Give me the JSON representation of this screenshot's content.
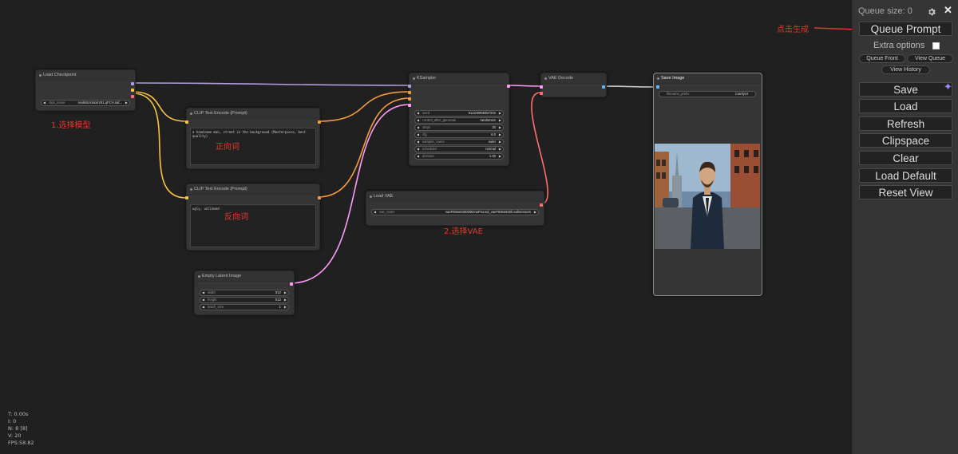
{
  "nodes": {
    "load_checkpoint": {
      "title": "Load Checkpoint",
      "ckpt_name_label": "ckpt_name",
      "ckpt_name_value": "realisticVisionV51.qFCH.saf..."
    },
    "clip_pos": {
      "title": "CLIP Text Encode (Prompt)",
      "text": "a handsome man, street in the background (Masterpiece, best quality)"
    },
    "clip_neg": {
      "title": "CLIP Text Encode (Prompt)",
      "text": "ugly, unlimned"
    },
    "empty_latent": {
      "title": "Empty Latent Image",
      "widgets": [
        {
          "name": "width",
          "value": "512"
        },
        {
          "name": "height",
          "value": "512"
        },
        {
          "name": "batch_size",
          "value": "1"
        }
      ]
    },
    "ksampler": {
      "title": "KSampler",
      "widgets": [
        {
          "name": "seed",
          "value": "511100958357202"
        },
        {
          "name": "control_after_generate",
          "value": "randomize"
        },
        {
          "name": "steps",
          "value": "20"
        },
        {
          "name": "cfg",
          "value": "6.0"
        },
        {
          "name": "sampler_name",
          "value": "euler"
        },
        {
          "name": "scheduler",
          "value": "normal"
        },
        {
          "name": "denoise",
          "value": "1.00"
        }
      ]
    },
    "vae_decode": {
      "title": "VAE Decode"
    },
    "load_vae": {
      "title": "Load VAE",
      "vae_name_label": "vae_name",
      "vae_name_value": "vaeFtMse840000EmaPruned_vaeFtMse840k.safetensors"
    },
    "save_image": {
      "title": "Save Image",
      "prefix_label": "filename_prefix",
      "prefix_value": "ComfyUI"
    }
  },
  "annotations": {
    "select_model": "1.选择模型",
    "positive": "正向词",
    "negative": "反向词",
    "select_vae": "2.选择VAE",
    "click_generate": "点击生成"
  },
  "stats": [
    "T: 0.00s",
    "I: 0",
    "N: 8 [8]",
    "V: 20",
    "FPS:58.82"
  ],
  "panel": {
    "queue_size": "Queue size: 0",
    "queue_prompt": "Queue Prompt",
    "extra_options": "Extra options",
    "queue_front": "Queue Front",
    "view_queue": "View Queue",
    "view_history": "View History",
    "buttons": [
      "Save",
      "Load",
      "Refresh",
      "Clipspace",
      "Clear",
      "Load Default",
      "Reset View"
    ]
  },
  "colors": {
    "model": "#b39ddb",
    "clip": "#f6c343",
    "conditioning": "#f39c3c",
    "latent": "#ff9cf9",
    "vae": "#ff6e6e",
    "image": "#64b5f6",
    "annotation": "#e0392b",
    "background": "#202020",
    "panel": "#353535"
  }
}
